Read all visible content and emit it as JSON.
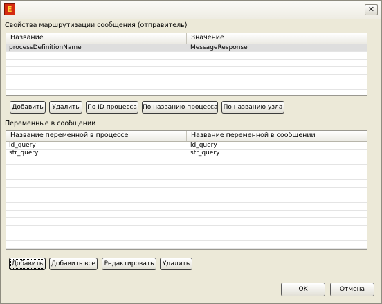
{
  "routing": {
    "title": "Свойства маршрутизации сообщения (отправитель)",
    "columns": [
      "Название",
      "Значение"
    ],
    "rows": [
      [
        "processDefinitionName",
        "MessageResponse"
      ]
    ],
    "buttons": {
      "add": "Добавить",
      "remove": "Удалить",
      "by_process_id": "По ID процесса",
      "by_process_name": "По названию процесса",
      "by_node_name": "По названию узла"
    }
  },
  "variables": {
    "title": "Переменные в сообщении",
    "columns": [
      "Название переменной в процессе",
      "Название переменной в сообщении"
    ],
    "rows": [
      [
        "id_query",
        "id_query"
      ],
      [
        "str_query",
        "str_query"
      ]
    ],
    "buttons": {
      "add": "Добавить",
      "add_all": "Добавить все",
      "edit": "Редактировать",
      "remove": "Удалить"
    }
  },
  "dialog": {
    "ok": "OK",
    "cancel": "Отмена"
  },
  "icons": {
    "app": "app-icon",
    "close": "close-icon"
  }
}
